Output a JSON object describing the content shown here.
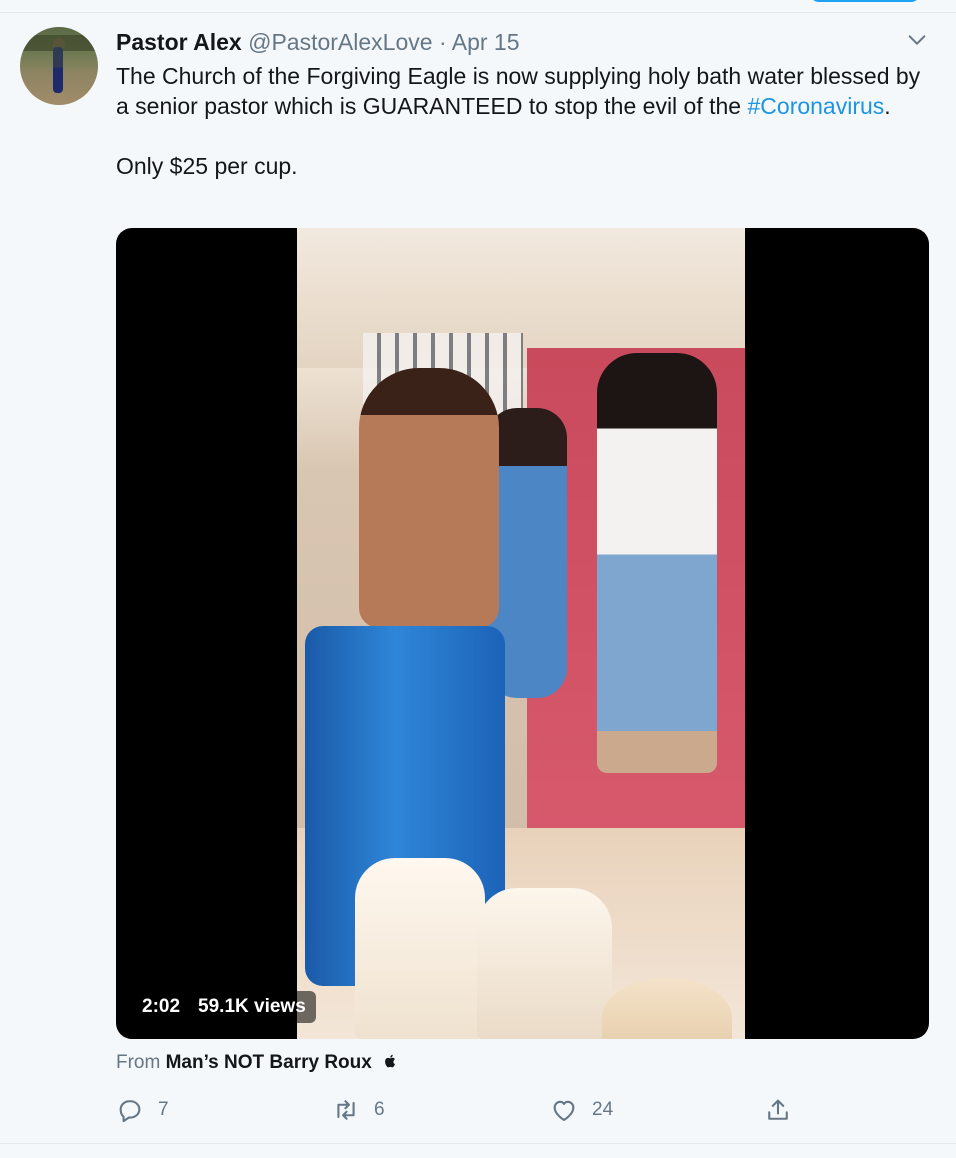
{
  "tweet": {
    "author_name": "Pastor Alex",
    "author_handle": "@PastorAlexLove",
    "separator": "·",
    "date": "Apr 15",
    "text_line1_before": "The Church of the Forgiving Eagle is now supplying holy bath water blessed by a senior pastor which is GUARANTEED to stop the evil of the",
    "hashtag": "#Coronavirus",
    "text_line1_after": ".",
    "text_line2": "Only $25 per cup."
  },
  "video": {
    "duration": "2:02",
    "views": "59.1K views"
  },
  "source": {
    "prefix": "From",
    "name": "Man’s NOT Barry Roux"
  },
  "actions": {
    "replies": "7",
    "retweets": "6",
    "likes": "24"
  },
  "icons": [
    "caret-down-icon",
    "reply-icon",
    "retweet-icon",
    "like-icon",
    "share-icon",
    "apple-icon"
  ],
  "colors": {
    "accent": "#1da1f2",
    "hashtag": "#1b95e0",
    "secondary_text": "#657786",
    "background": "#f5f8fa"
  }
}
